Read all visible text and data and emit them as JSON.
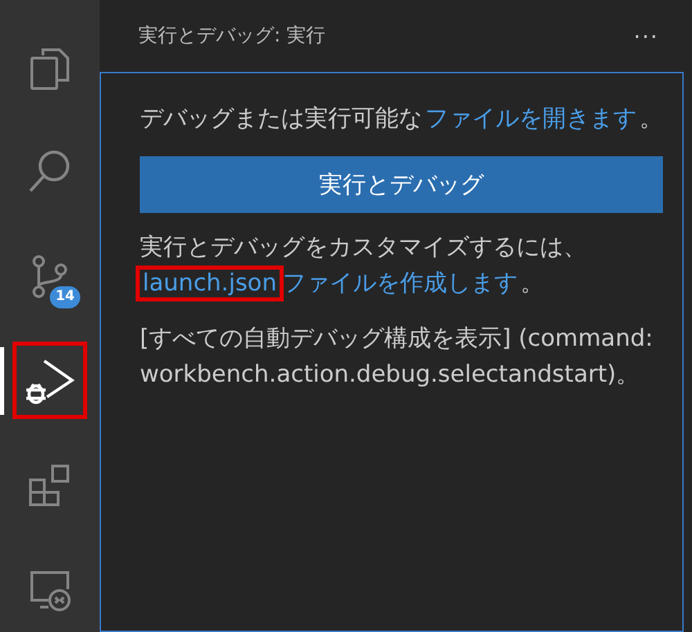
{
  "activity_bar": {
    "items": [
      {
        "kind": "files",
        "selected": false,
        "highlighted": false
      },
      {
        "kind": "search",
        "selected": false,
        "highlighted": false
      },
      {
        "kind": "source_control",
        "selected": false,
        "highlighted": false,
        "badge": "14"
      },
      {
        "kind": "run_debug",
        "selected": true,
        "highlighted": true
      },
      {
        "kind": "extensions",
        "selected": false,
        "highlighted": false
      },
      {
        "kind": "remote",
        "selected": false,
        "highlighted": false
      }
    ]
  },
  "sidebar": {
    "title": "実行とデバッグ: 実行",
    "more": "···",
    "blocks": [
      {
        "kind": "paragraph",
        "parts": [
          {
            "kind": "text",
            "text": "デバッグまたは実行可能な"
          },
          {
            "kind": "link",
            "text": "ファイルを開きます",
            "highlighted": false
          },
          {
            "kind": "text",
            "text": "。"
          }
        ]
      },
      {
        "kind": "button",
        "text": "実行とデバッグ"
      },
      {
        "kind": "paragraph",
        "parts": [
          {
            "kind": "text",
            "text": "実行とデバッグをカスタマイズするには、"
          },
          {
            "kind": "link",
            "text": "launch.json",
            "highlighted": true
          },
          {
            "kind": "link",
            "text": "ファイルを作成します",
            "highlighted": false
          },
          {
            "kind": "text",
            "text": "。"
          }
        ]
      },
      {
        "kind": "paragraph",
        "parts": [
          {
            "kind": "text",
            "text": "[すべての自動デバッグ構成を表示] (command: workbench.action.debug.selectandstart)。"
          }
        ]
      }
    ]
  }
}
